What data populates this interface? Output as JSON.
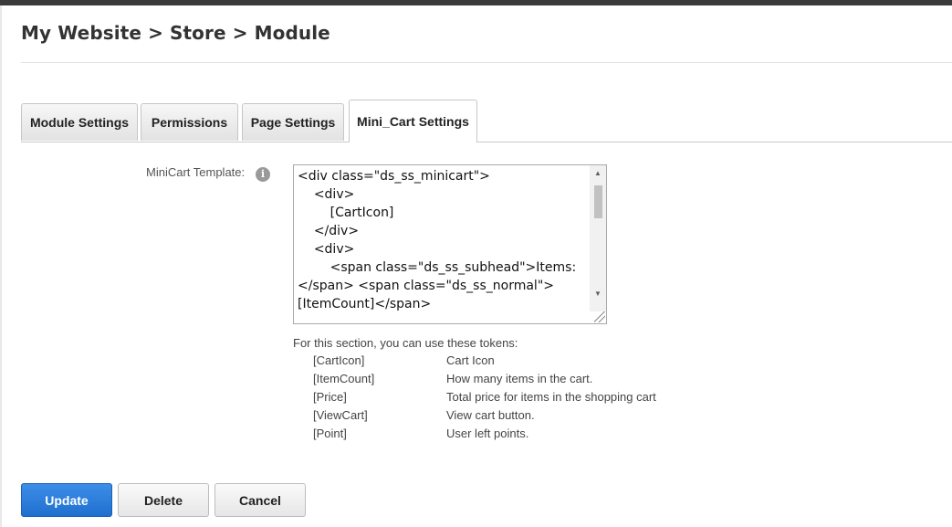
{
  "breadcrumb": "My Website > Store > Module",
  "tabs": [
    {
      "label": "Module Settings",
      "active": false
    },
    {
      "label": "Permissions",
      "active": false
    },
    {
      "label": "Page Settings",
      "active": false
    },
    {
      "label": "Mini_Cart Settings",
      "active": true
    }
  ],
  "minicart": {
    "label": "MiniCart Template:",
    "info_icon": "info-icon",
    "template_value": "<div class=\"ds_ss_minicart\">\n\t<div>\n\t\t[CartIcon]\n\t</div>\n\t<div>\n\t\t<span class=\"ds_ss_subhead\">Items:</span> <span class=\"ds_ss_normal\">[ItemCount]</span>\n"
  },
  "help": {
    "intro": "For this section, you can use these tokens:",
    "tokens": [
      {
        "token": "[CartIcon]",
        "desc": "Cart Icon"
      },
      {
        "token": "[ItemCount]",
        "desc": "How many items in the cart."
      },
      {
        "token": "[Price]",
        "desc": "Total price for items in the shopping cart"
      },
      {
        "token": "[ViewCart]",
        "desc": "View cart button."
      },
      {
        "token": "[Point]",
        "desc": "User left points."
      }
    ]
  },
  "buttons": {
    "update": "Update",
    "delete": "Delete",
    "cancel": "Cancel"
  },
  "colors": {
    "primary": "#2a7fe0"
  }
}
